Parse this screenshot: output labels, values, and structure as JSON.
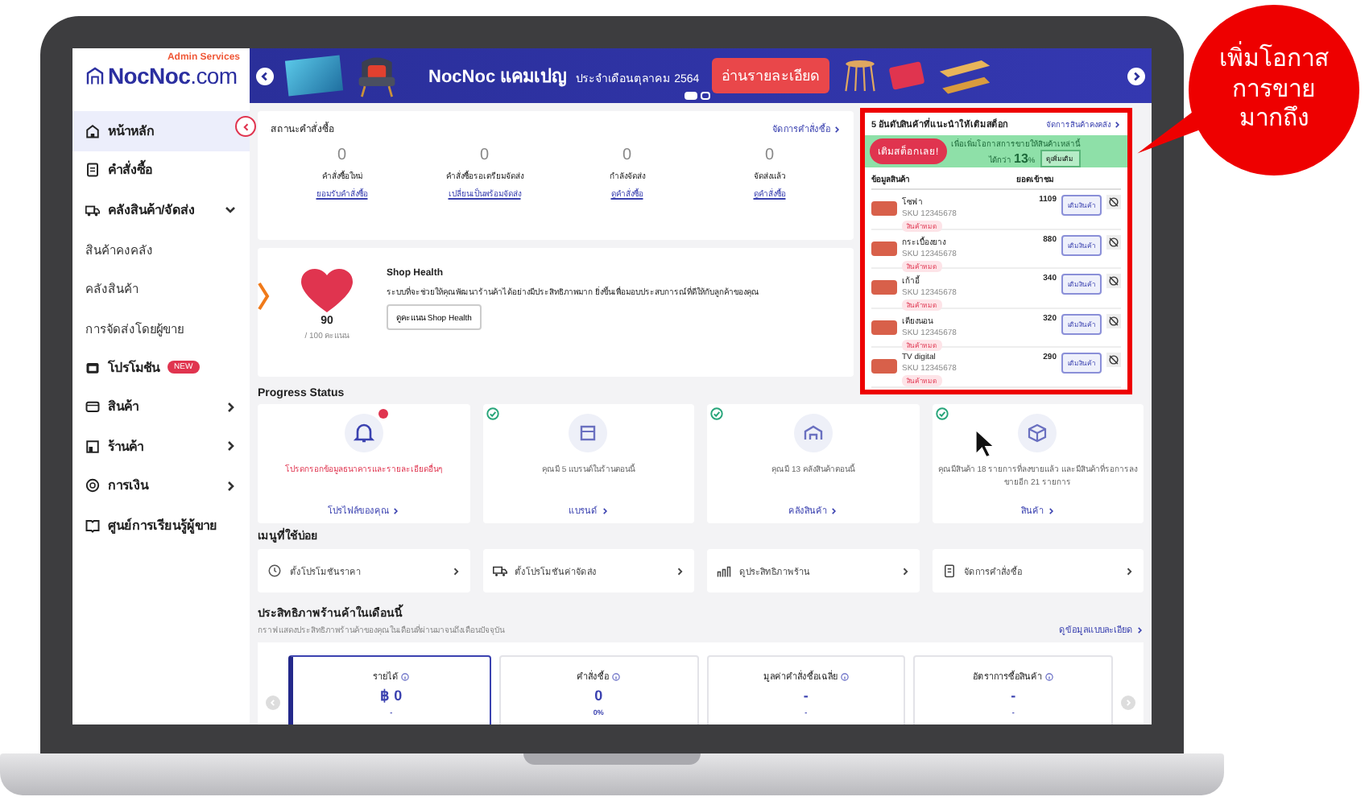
{
  "callout": {
    "text": "เพิ่มโอกาส\nการขาย\nมากถึง"
  },
  "sidebar": {
    "logo": {
      "tagline": "Admin Services",
      "name": "NocNoc",
      "suffix": ".com"
    },
    "items": [
      {
        "label": "หน้าหลัก",
        "selected": true
      },
      {
        "label": "คำสั่งซื้อ",
        "selected": false
      },
      {
        "label": "คลังสินค้า/จัดส่ง",
        "selected": false,
        "expanded": true,
        "children": [
          {
            "label": "สินค้าคงคลัง",
            "selected": false
          },
          {
            "label": "คลังสินค้า",
            "selected": false
          },
          {
            "label": "การจัดส่งโดยผู้ขาย",
            "selected": false
          }
        ]
      },
      {
        "label": "โปรโมชัน",
        "selected": false,
        "badge": "NEW"
      },
      {
        "label": "สินค้า",
        "selected": false,
        "expanded": false
      },
      {
        "label": "ร้านค้า",
        "selected": false,
        "expanded": false
      },
      {
        "label": "การเงิน",
        "selected": false,
        "expanded": false
      },
      {
        "label": "ศูนย์การเรียนรู้ผู้ขาย",
        "selected": false
      }
    ]
  },
  "banner": {
    "title": "NocNoc แคมเปญ",
    "subtitle": "ประจำเดือนตุลาคม 2564",
    "button": "อ่านรายละเอียด",
    "slides": [
      {
        "selected": true
      },
      {
        "selected": false
      }
    ]
  },
  "order_status": {
    "title": "สถานะคำสั่งซื้อ",
    "link": "จัดการคำสั่งซื้อ",
    "stats": [
      {
        "value": "0",
        "label": "คำสั่งซื้อใหม่",
        "link": "ยอมรับคำสั่งซื้อ"
      },
      {
        "value": "0",
        "label": "คำสั่งซื้อรอเตรียมจัดส่ง",
        "link": "เปลี่ยนเป็นพร้อมจัดส่ง"
      },
      {
        "value": "0",
        "label": "กำลังจัดส่ง",
        "link": "ดูคำสั่งซื้อ"
      },
      {
        "value": "0",
        "label": "จัดส่งแล้ว",
        "link": "ดูคำสั่งซื้อ"
      }
    ]
  },
  "shop_health": {
    "score": "90",
    "max": "/ 100 คะแนน",
    "title": "Shop Health",
    "description": "ระบบที่จะช่วยให้คุณพัฒนาร้านค้าได้อย่างมีประสิทธิภาพมาก ยิ่งขึ้นเพื่อมอบประสบการณ์ที่ดีให้กับลูกค้าของคุณ",
    "button": "ดูคะแนน Shop Health"
  },
  "stock": {
    "title": "5 อันดับสินค้าที่แนะนำให้เติมสต็อก",
    "link": "จัดการสินค้าคงคลัง",
    "promo": {
      "button": "เติมสต็อกเลย!",
      "text": "เพื่อเพิ่มโอกาสการขายให้สินค้าเหล่านี้",
      "prefix": "ได้กว่า",
      "percent": "13",
      "unit": "%",
      "more": "ดูเพิ่มเติม"
    },
    "columns": [
      "ข้อมูลสินค้า",
      "ยอดเข้าชม"
    ],
    "rows": [
      {
        "name": "โซฟา",
        "sku": "SKU 12345678",
        "tag": "สินค้าหมด",
        "views": "1109",
        "button": "เติมสินค้า"
      },
      {
        "name": "กระเบื้องยาง",
        "sku": "SKU 12345678",
        "tag": "สินค้าหมด",
        "views": "880",
        "button": "เติมสินค้า"
      },
      {
        "name": "เก้าอี้",
        "sku": "SKU 12345678",
        "tag": "สินค้าหมด",
        "views": "340",
        "button": "เติมสินค้า"
      },
      {
        "name": "เตียงนอน",
        "sku": "SKU 12345678",
        "tag": "สินค้าหมด",
        "views": "320",
        "button": "เติมสินค้า"
      },
      {
        "name": "TV digital",
        "sku": "SKU 12345678",
        "tag": "สินค้าหมด",
        "views": "290",
        "button": "เติมสินค้า"
      }
    ]
  },
  "progress": {
    "title": "Progress Status",
    "cards": [
      {
        "done": false,
        "text": "โปรดกรอกข้อมูลธนาคารและรายละเอียดอื่นๆ",
        "link": "โปรไฟล์ของคุณ"
      },
      {
        "done": true,
        "text": "คุณมี 5 แบรนด์ในร้านตอนนี้",
        "link": "แบรนด์"
      },
      {
        "done": true,
        "text": "คุณมี 13 คลังสินค้าตอนนี้",
        "link": "คลังสินค้า"
      },
      {
        "done": true,
        "text": "คุณมีสินค้า 18 รายการที่ลงขายแล้ว และมีสินค้าที่รอการลงขายอีก 21 รายการ",
        "link": "สินค้า"
      }
    ]
  },
  "shortcuts": {
    "title": "เมนูที่ใช้บ่อย",
    "items": [
      "ตั้งโปรโมชันราคา",
      "ตั้งโปรโมชันค่าจัดส่ง",
      "ดูประสิทธิภาพร้าน",
      "จัดการคำสั่งซื้อ"
    ]
  },
  "performance": {
    "title": "ประสิทธิภาพร้านค้าในเดือนนี้",
    "subtitle": "กราฟแสดงประสิทธิภาพร้านค้าของคุณในเดือนที่ผ่านมาจนถึงเดือนปัจจุบัน",
    "link": "ดูข้อมูลแบบละเอียด",
    "metrics": [
      {
        "label": "รายได้",
        "value": "฿ 0",
        "change": "-",
        "selected": true
      },
      {
        "label": "คำสั่งซื้อ",
        "value": "0",
        "change": "0%",
        "selected": false
      },
      {
        "label": "มูลค่าคำสั่งซื้อเฉลี่ย",
        "value": "-",
        "change": "-",
        "selected": false
      },
      {
        "label": "อัตราการซื้อสินค้า",
        "value": "-",
        "change": "-",
        "selected": false
      }
    ]
  }
}
